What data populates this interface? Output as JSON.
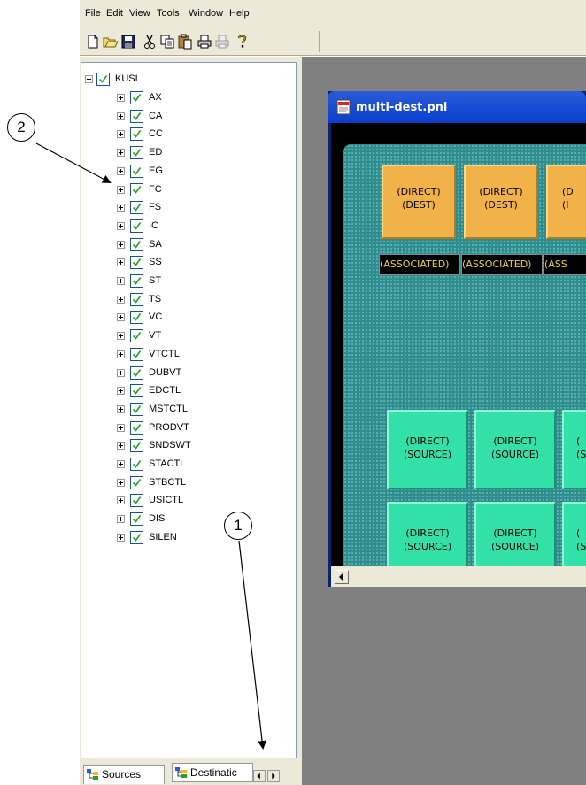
{
  "menu": [
    "File",
    "Edit",
    "View",
    "Tools",
    "Window",
    "Help"
  ],
  "toolbar": {
    "icons": [
      "new-icon",
      "open-icon",
      "save-icon",
      "cut-icon",
      "copy-icon",
      "paste-icon",
      "print-icon",
      "print-preview-icon",
      "help-icon"
    ]
  },
  "tree": {
    "root": "KUSI",
    "items": [
      "AX",
      "CA",
      "CC",
      "ED",
      "EG",
      "FC",
      "FS",
      "IC",
      "SA",
      "SS",
      "ST",
      "TS",
      "VC",
      "VT",
      "VTCTL",
      "DUBVT",
      "EDCTL",
      "MSTCTL",
      "PRODVT",
      "SNDSWT",
      "STACTL",
      "STBCTL",
      "USICTL",
      "DIS",
      "SILEN"
    ]
  },
  "tabs": {
    "sources": "Sources",
    "destinations": "Destinatic"
  },
  "document": {
    "title": "multi-dest.pnl",
    "dest_line1": "(DIRECT)",
    "dest_line2": "(DEST)",
    "dest_partial1": "(D",
    "dest_partial2": "(I",
    "associated": "(ASSOCIATED)",
    "associated_partial": "(ASS",
    "src_line1": "(DIRECT)",
    "src_line2": "(SOURCE)",
    "src_partial1": "(",
    "src_partial2": "(S"
  },
  "callouts": {
    "one": "1",
    "two": "2"
  }
}
